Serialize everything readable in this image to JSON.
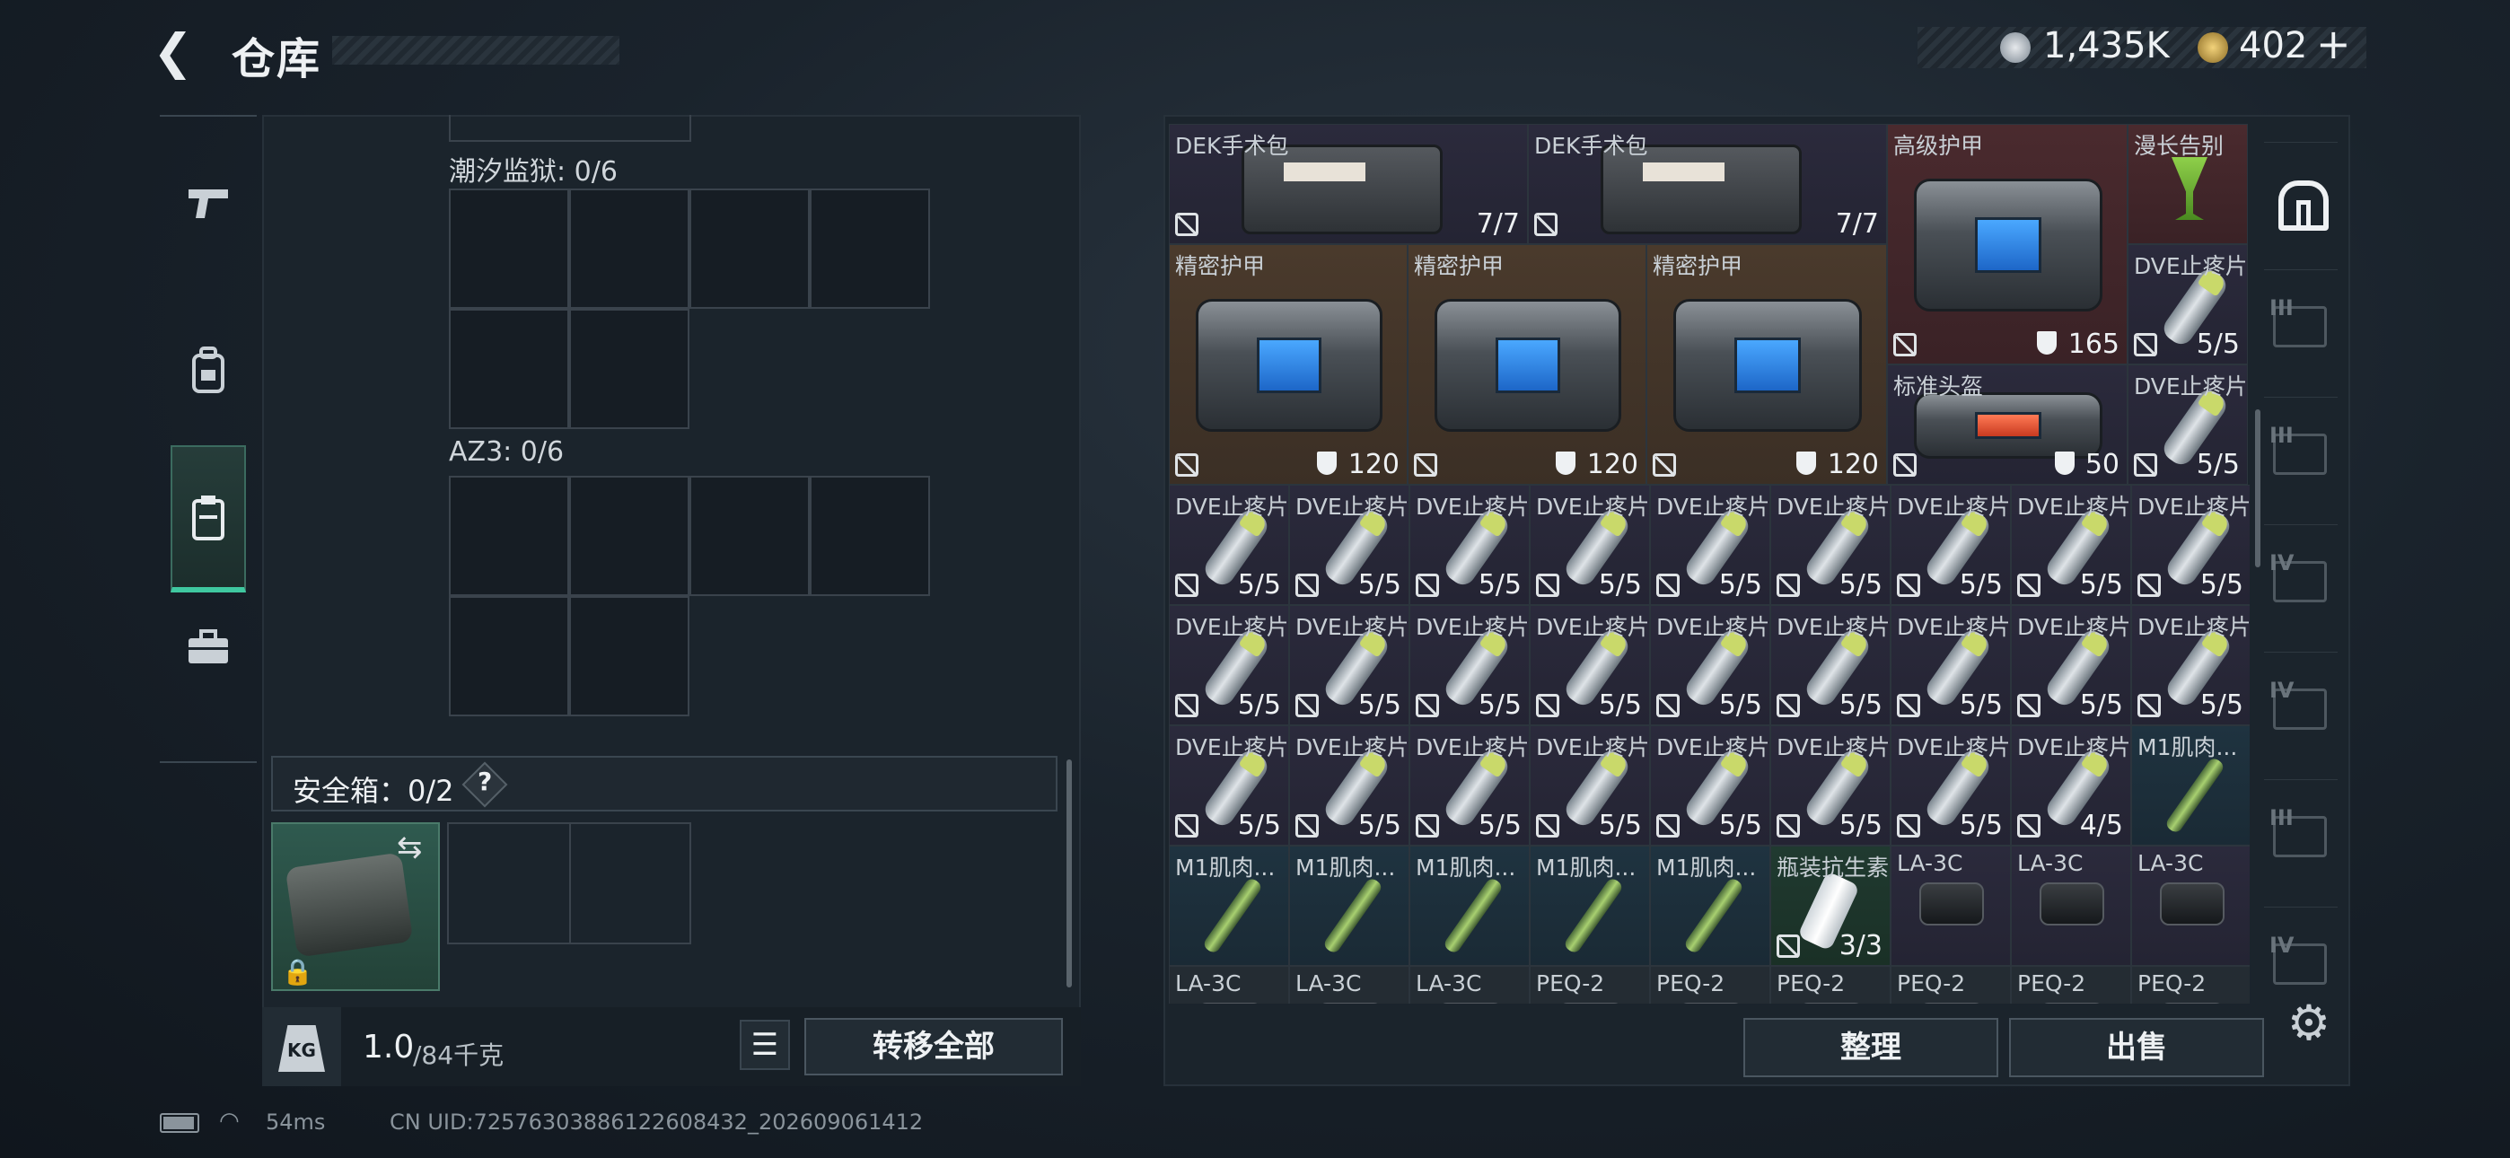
{
  "header": {
    "back_icon": "chevron-left-icon",
    "title": "仓库"
  },
  "currency": {
    "silver_icon": "silver-coin-icon",
    "silver": "1,435K",
    "gold_icon": "gold-coin-icon",
    "gold": "402",
    "plus": "+"
  },
  "left_nav": [
    "pistol-icon",
    "backpack-icon",
    "chest-rig-icon",
    "briefcase-icon"
  ],
  "left_nav_active": 2,
  "left_panel": {
    "container1_label": "潮汐监狱: 0/6",
    "container2_label": "AZ3: 0/6",
    "safebox_label": "安全箱：0/2",
    "safebox_help": "?",
    "weight_icon": "KG",
    "weight_value": "1.0",
    "weight_unit": "/84千克",
    "list_icon": "list-icon",
    "transfer_all": "转移全部"
  },
  "inventory": {
    "items": [
      {
        "name": "DEK手术包",
        "count": "7/7",
        "type": "kit",
        "bg": "purple"
      },
      {
        "name": "DEK手术包",
        "count": "7/7",
        "type": "kit",
        "bg": "purple"
      },
      {
        "name": "高级护甲",
        "count": "165",
        "type": "armor",
        "bg": "red",
        "armor": true
      },
      {
        "name": "漫长告别",
        "count": "",
        "type": "drink",
        "bg": "red"
      },
      {
        "name": "精密护甲",
        "count": "120",
        "type": "armor",
        "bg": "orange",
        "armor": true
      },
      {
        "name": "精密护甲",
        "count": "120",
        "type": "armor",
        "bg": "orange",
        "armor": true
      },
      {
        "name": "精密护甲",
        "count": "120",
        "type": "armor",
        "bg": "orange",
        "armor": true
      },
      {
        "name": "DVE止疼片",
        "count": "5/5",
        "type": "pill",
        "bg": "purple"
      },
      {
        "name": "标准头盔",
        "count": "50",
        "type": "helmet",
        "bg": "purple",
        "armor": true
      },
      {
        "name": "DVE止疼片",
        "count": "5/5",
        "type": "pill",
        "bg": "purple"
      },
      {
        "name": "DVE止疼片",
        "count": "5/5",
        "type": "pill",
        "bg": "purple"
      },
      {
        "name": "DVE止疼片",
        "count": "5/5",
        "type": "pill",
        "bg": "purple"
      },
      {
        "name": "DVE止疼片",
        "count": "5/5",
        "type": "pill",
        "bg": "purple"
      },
      {
        "name": "DVE止疼片",
        "count": "5/5",
        "type": "pill",
        "bg": "purple"
      },
      {
        "name": "DVE止疼片",
        "count": "5/5",
        "type": "pill",
        "bg": "purple"
      },
      {
        "name": "DVE止疼片",
        "count": "5/5",
        "type": "pill",
        "bg": "purple"
      },
      {
        "name": "DVE止疼片",
        "count": "5/5",
        "type": "pill",
        "bg": "purple"
      },
      {
        "name": "DVE止疼片",
        "count": "5/5",
        "type": "pill",
        "bg": "purple"
      },
      {
        "name": "DVE止疼片",
        "count": "5/5",
        "type": "pill",
        "bg": "purple"
      },
      {
        "name": "DVE止疼片",
        "count": "5/5",
        "type": "pill",
        "bg": "purple"
      },
      {
        "name": "DVE止疼片",
        "count": "5/5",
        "type": "pill",
        "bg": "purple"
      },
      {
        "name": "DVE止疼片",
        "count": "5/5",
        "type": "pill",
        "bg": "purple"
      },
      {
        "name": "DVE止疼片",
        "count": "5/5",
        "type": "pill",
        "bg": "purple"
      },
      {
        "name": "DVE止疼片",
        "count": "5/5",
        "type": "pill",
        "bg": "purple"
      },
      {
        "name": "DVE止疼片",
        "count": "5/5",
        "type": "pill",
        "bg": "purple"
      },
      {
        "name": "DVE止疼片",
        "count": "5/5",
        "type": "pill",
        "bg": "purple"
      },
      {
        "name": "DVE止疼片",
        "count": "5/5",
        "type": "pill",
        "bg": "purple"
      },
      {
        "name": "DVE止疼片",
        "count": "5/5",
        "type": "pill",
        "bg": "purple"
      },
      {
        "name": "DVE止疼片",
        "count": "5/5",
        "type": "pill",
        "bg": "purple"
      },
      {
        "name": "DVE止疼片",
        "count": "5/5",
        "type": "pill",
        "bg": "purple"
      },
      {
        "name": "DVE止疼片",
        "count": "5/5",
        "type": "pill",
        "bg": "purple"
      },
      {
        "name": "DVE止疼片",
        "count": "5/5",
        "type": "pill",
        "bg": "purple"
      },
      {
        "name": "DVE止疼片",
        "count": "5/5",
        "type": "pill",
        "bg": "purple"
      },
      {
        "name": "DVE止疼片",
        "count": "5/5",
        "type": "pill",
        "bg": "purple"
      },
      {
        "name": "DVE止疼片",
        "count": "5/5",
        "type": "pill",
        "bg": "purple"
      },
      {
        "name": "DVE止疼片",
        "count": "4/5",
        "type": "pill",
        "bg": "purple"
      },
      {
        "name": "M1肌肉...",
        "count": "",
        "type": "syringe",
        "bg": "blue"
      },
      {
        "name": "M1肌肉...",
        "count": "",
        "type": "syringe",
        "bg": "blue"
      },
      {
        "name": "M1肌肉...",
        "count": "",
        "type": "syringe",
        "bg": "blue"
      },
      {
        "name": "M1肌肉...",
        "count": "",
        "type": "syringe",
        "bg": "blue"
      },
      {
        "name": "M1肌肉...",
        "count": "",
        "type": "syringe",
        "bg": "blue"
      },
      {
        "name": "M1肌肉...",
        "count": "",
        "type": "syringe",
        "bg": "blue"
      },
      {
        "name": "瓶装抗生素",
        "count": "3/3",
        "type": "bottle",
        "bg": "green"
      },
      {
        "name": "LA-3C",
        "count": "",
        "type": "gadget",
        "bg": "purple"
      },
      {
        "name": "LA-3C",
        "count": "",
        "type": "gadget",
        "bg": "purple"
      },
      {
        "name": "LA-3C",
        "count": "",
        "type": "gadget",
        "bg": "purple"
      },
      {
        "name": "LA-3C",
        "count": "",
        "type": "gadget",
        "bg": "gray"
      },
      {
        "name": "LA-3C",
        "count": "",
        "type": "gadget",
        "bg": "gray"
      },
      {
        "name": "LA-3C",
        "count": "",
        "type": "gadget",
        "bg": "gray"
      },
      {
        "name": "PEQ-2",
        "count": "",
        "type": "gadget",
        "bg": "gray"
      },
      {
        "name": "PEQ-2",
        "count": "",
        "type": "gadget",
        "bg": "gray"
      },
      {
        "name": "PEQ-2",
        "count": "",
        "type": "gadget",
        "bg": "gray"
      },
      {
        "name": "PEQ-2",
        "count": "",
        "type": "gadget",
        "bg": "gray"
      },
      {
        "name": "PEQ-2",
        "count": "",
        "type": "gadget",
        "bg": "gray"
      },
      {
        "name": "PEQ-2",
        "count": "",
        "type": "gadget",
        "bg": "gray"
      }
    ],
    "sort_button": "整理",
    "sell_button": "出售"
  },
  "right_nav": [
    {
      "icon": "warehouse-icon",
      "label": ""
    },
    {
      "icon": "weapon-tier-icon",
      "label": "III"
    },
    {
      "icon": "weapon-tier-icon",
      "label": "III"
    },
    {
      "icon": "container-tier-icon",
      "label": "IV"
    },
    {
      "icon": "container-tier-icon",
      "label": "IV"
    },
    {
      "icon": "container-tier-icon",
      "label": "III"
    },
    {
      "icon": "container-tier-icon",
      "label": "IV"
    }
  ],
  "settings_icon": "gear-icon",
  "status": {
    "battery_icon": "battery-icon",
    "wifi_icon": "wifi-icon",
    "ping": "54ms",
    "uid": "CN UID:72576303886122608432_202609061412"
  }
}
